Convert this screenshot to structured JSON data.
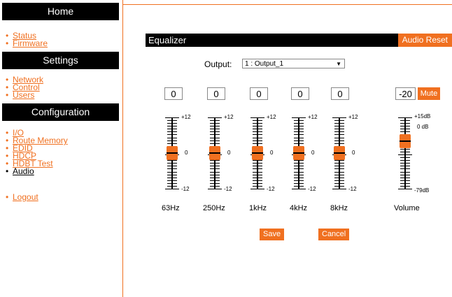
{
  "sidebar": {
    "home": {
      "title": "Home",
      "items": [
        "Status",
        "Firmware"
      ]
    },
    "settings": {
      "title": "Settings",
      "items": [
        "Network",
        "Control",
        "Users"
      ]
    },
    "configuration": {
      "title": "Configuration",
      "items": [
        "I/O",
        "Route Memory",
        "EDID",
        "HDCP",
        "HDBT Test",
        "Audio"
      ],
      "active": "Audio"
    },
    "logout": "Logout"
  },
  "equalizer": {
    "title": "Equalizer",
    "audio_reset": "Audio Reset",
    "output_label": "Output:",
    "output_value": "1 : Output_1",
    "bands": [
      {
        "label": "63Hz",
        "value": "0"
      },
      {
        "label": "250Hz",
        "value": "0"
      },
      {
        "label": "1kHz",
        "value": "0"
      },
      {
        "label": "4kHz",
        "value": "0"
      },
      {
        "label": "8kHz",
        "value": "0"
      }
    ],
    "band_scale": {
      "max": "+12",
      "mid": "0",
      "min": "-12"
    },
    "volume": {
      "label": "Volume",
      "value": "-20",
      "mute": "Mute",
      "scale_max": "+15dB",
      "scale_zero": "0 dB",
      "scale_min": "-79dB"
    },
    "save": "Save",
    "cancel": "Cancel"
  },
  "colors": {
    "accent": "#f07020",
    "header_bg": "#000000"
  }
}
